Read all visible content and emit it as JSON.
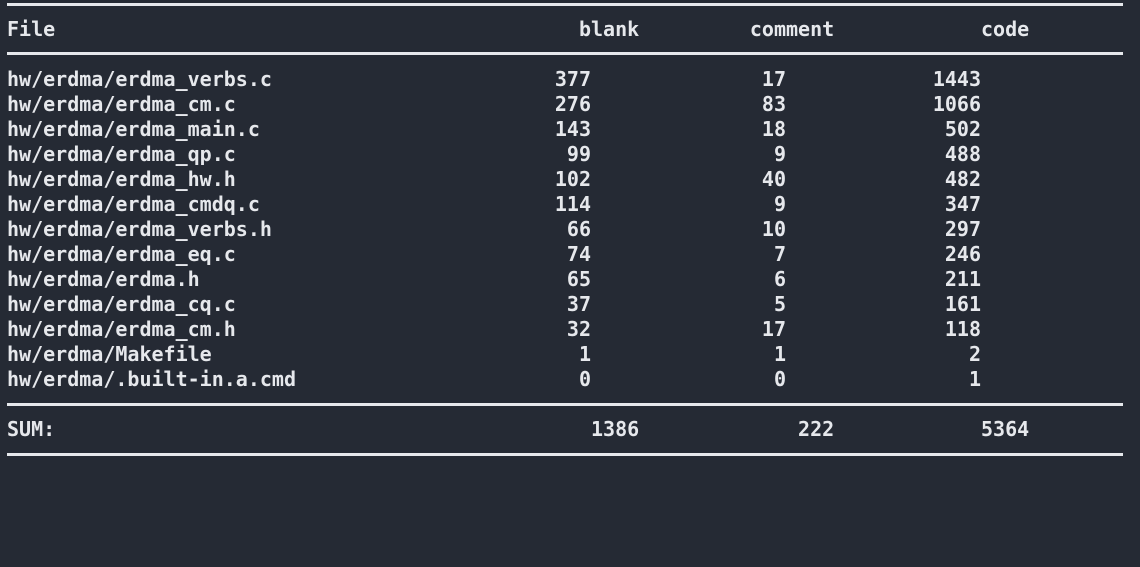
{
  "header": {
    "file": "File",
    "blank": "blank",
    "comment": "comment",
    "code": "code"
  },
  "rows": [
    {
      "file": "hw/erdma/erdma_verbs.c",
      "blank": "377",
      "comment": "17",
      "code": "1443"
    },
    {
      "file": "hw/erdma/erdma_cm.c",
      "blank": "276",
      "comment": "83",
      "code": "1066"
    },
    {
      "file": "hw/erdma/erdma_main.c",
      "blank": "143",
      "comment": "18",
      "code": "502"
    },
    {
      "file": "hw/erdma/erdma_qp.c",
      "blank": "99",
      "comment": "9",
      "code": "488"
    },
    {
      "file": "hw/erdma/erdma_hw.h",
      "blank": "102",
      "comment": "40",
      "code": "482"
    },
    {
      "file": "hw/erdma/erdma_cmdq.c",
      "blank": "114",
      "comment": "9",
      "code": "347"
    },
    {
      "file": "hw/erdma/erdma_verbs.h",
      "blank": "66",
      "comment": "10",
      "code": "297"
    },
    {
      "file": "hw/erdma/erdma_eq.c",
      "blank": "74",
      "comment": "7",
      "code": "246"
    },
    {
      "file": "hw/erdma/erdma.h",
      "blank": "65",
      "comment": "6",
      "code": "211"
    },
    {
      "file": "hw/erdma/erdma_cq.c",
      "blank": "37",
      "comment": "5",
      "code": "161"
    },
    {
      "file": "hw/erdma/erdma_cm.h",
      "blank": "32",
      "comment": "17",
      "code": "118"
    },
    {
      "file": "hw/erdma/Makefile",
      "blank": "1",
      "comment": "1",
      "code": "2"
    },
    {
      "file": "hw/erdma/.built-in.a.cmd",
      "blank": "0",
      "comment": "0",
      "code": "1"
    }
  ],
  "sum": {
    "label": "SUM:",
    "blank": "1386",
    "comment": "222",
    "code": "5364"
  },
  "colors": {
    "background": "#252a34",
    "foreground": "#e6e8ec"
  }
}
